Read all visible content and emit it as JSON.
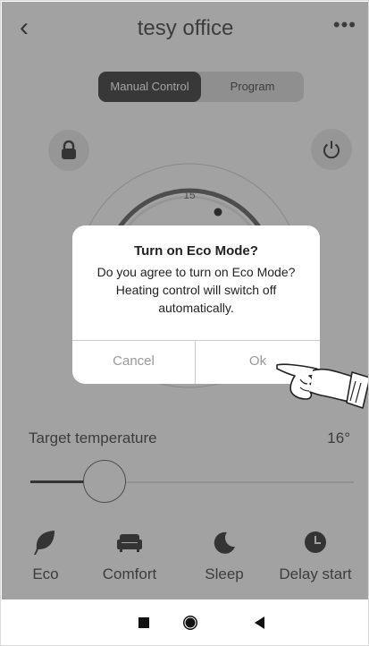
{
  "header": {
    "title": "tesy office",
    "back_glyph": "‹",
    "more_glyph": "•••"
  },
  "mode_switch": {
    "active": "Manual Control",
    "inactive": "Program"
  },
  "buttons": {
    "lock_icon": "lock-icon",
    "power_icon": "power-icon"
  },
  "dial": {
    "current_temp_label": "15"
  },
  "target": {
    "label": "Target temperature",
    "value": "16°",
    "slider_fraction": 0.23
  },
  "modes": [
    {
      "label": "Eco",
      "icon": "leaf-icon"
    },
    {
      "label": "Comfort",
      "icon": "sofa-icon"
    },
    {
      "label": "Sleep",
      "icon": "moon-icon"
    },
    {
      "label": "Delay start",
      "icon": "clock-icon"
    }
  ],
  "dialog": {
    "title": "Turn on Eco Mode?",
    "message": "Do you agree to turn on Eco Mode? Heating control will switch off automatically.",
    "cancel": "Cancel",
    "ok": "Ok"
  },
  "colors": {
    "dark": "#2a2a2a",
    "overlay": "rgba(70,70,70,0.5)",
    "muted": "#999999"
  }
}
